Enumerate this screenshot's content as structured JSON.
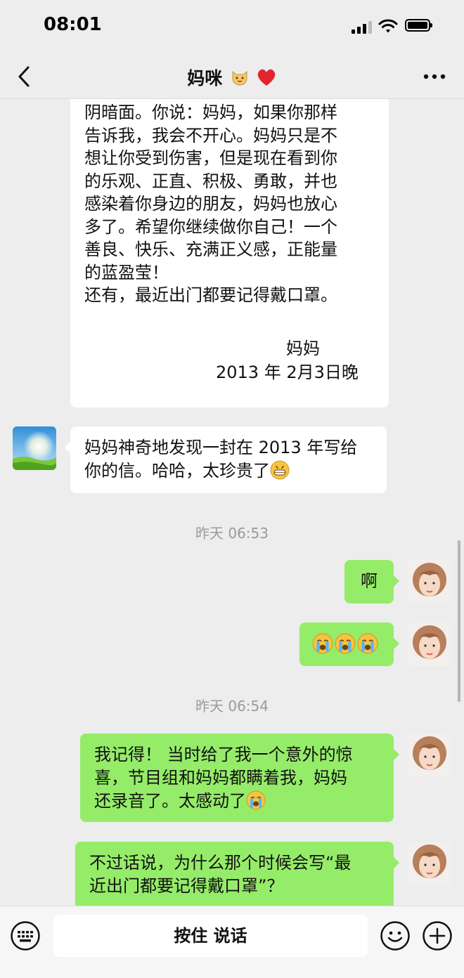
{
  "status_bar": {
    "time": "08:01"
  },
  "nav": {
    "title": "妈咪"
  },
  "letter_lines": [
    "阴暗面。你说：妈妈，如果你那样",
    "告诉我，我会不开心。妈妈只是不",
    "想让你受到伤害，但是现在看到你",
    "的乐观、正直、积极、勇敢，并也",
    "感染着你身边的朋友，妈妈也放心",
    "多了。希望你继续做你自己！一个",
    "善良、快乐、充满正义感，正能量",
    "的蓝盈莹！",
    "还有，最近出门都要记得戴口罩。"
  ],
  "letter_signature": "妈妈",
  "letter_date": "2013 年 2月3日晚",
  "msg_mom": {
    "line1": "妈妈神奇地发现一封在 2013 年写给",
    "line2": "你的信。哈哈，太珍贵了"
  },
  "timestamp_1": "昨天 06:53",
  "msg_ah": "啊",
  "timestamp_2": "昨天 06:54",
  "msg_remember": {
    "line1": "我记得！ 当时给了我一个意外的惊",
    "line2": "喜，节目组和妈妈都瞒着我，妈妈",
    "line3": "还录音了。太感动了"
  },
  "msg_question": {
    "line1": "不过话说，为什么那个时候会写“最",
    "line2": "近出门都要记得戴口罩”？"
  },
  "input": {
    "hold_to_talk": "按住 说话"
  },
  "icons": {
    "back": "chevron-left-icon",
    "more": "more-dots-icon",
    "keyboard": "keyboard-icon",
    "emoji": "smiley-icon",
    "plus": "plus-icon"
  },
  "colors": {
    "outgoing_bubble": "#95ec69",
    "incoming_bubble": "#ffffff",
    "background": "#ededed"
  }
}
